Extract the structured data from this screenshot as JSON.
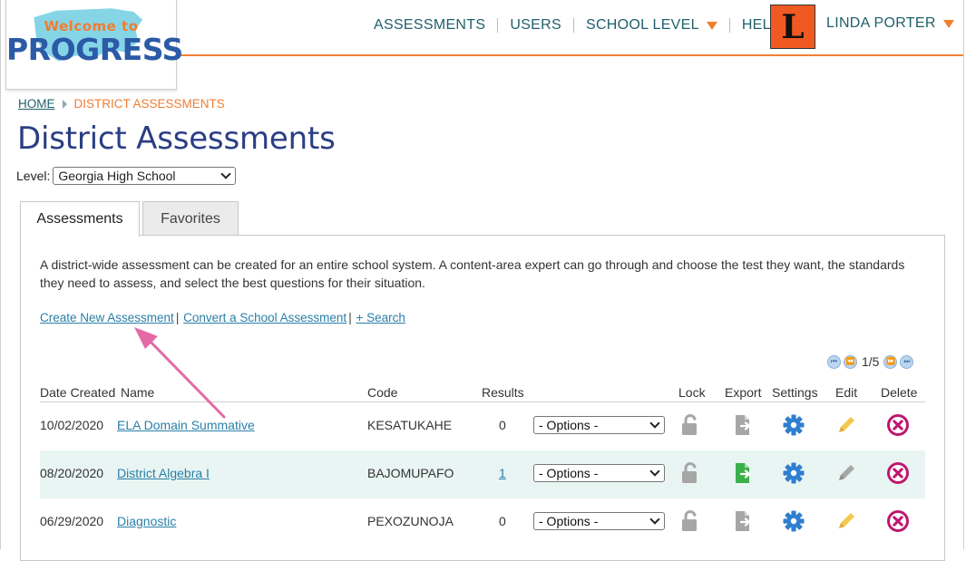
{
  "logo": {
    "line1": "Welcome to",
    "line2": "PROGRESS"
  },
  "nav": {
    "items": [
      {
        "label": "ASSESSMENTS",
        "has_caret": false
      },
      {
        "label": "USERS",
        "has_caret": false
      },
      {
        "label": "SCHOOL LEVEL",
        "has_caret": true
      },
      {
        "label": "HELP",
        "has_caret": true
      }
    ],
    "avatar_letter": "L",
    "user_name": "LINDA PORTER"
  },
  "breadcrumb": {
    "home": "HOME",
    "current": "DISTRICT ASSESSMENTS"
  },
  "page_title": "District Assessments",
  "level": {
    "label": "Level:",
    "selected": "Georgia High School"
  },
  "tabs": [
    {
      "label": "Assessments",
      "active": true
    },
    {
      "label": "Favorites",
      "active": false
    }
  ],
  "description": "A district-wide assessment can be created for an entire school system. A content-area expert can go through and choose the test they want, the standards they need to assess, and select the best questions for their situation.",
  "links": {
    "create": "Create New Assessment",
    "convert": "Convert a School Assessment",
    "search": "+ Search",
    "separator": "|"
  },
  "pager": {
    "count": "1/5"
  },
  "table": {
    "headers": {
      "date": "Date Created",
      "name": "Name",
      "code": "Code",
      "results": "Results",
      "lock": "Lock",
      "export": "Export",
      "settings": "Settings",
      "edit": "Edit",
      "delete": "Delete"
    },
    "rows": [
      {
        "date": "10/02/2020",
        "name": "ELA Domain Summative",
        "code": "KESATUKAHE",
        "results": "0",
        "results_link": false,
        "options": "- Options -",
        "export_active": false,
        "edit_active": true
      },
      {
        "date": "08/20/2020",
        "name": "District Algebra I",
        "code": "BAJOMUPAFO",
        "results": "1",
        "results_link": true,
        "options": "- Options -",
        "export_active": true,
        "edit_active": false
      },
      {
        "date": "06/29/2020",
        "name": "Diagnostic",
        "code": "PEXOZUNOJA",
        "results": "0",
        "results_link": false,
        "options": "- Options -",
        "export_active": false,
        "edit_active": true
      }
    ]
  },
  "colors": {
    "accent_orange": "#ef7d33",
    "nav_teal": "#1f5f6b",
    "title_navy": "#2a3e84",
    "link_blue": "#2a7fa8",
    "settings_blue": "#2f7fd0",
    "delete_magenta": "#c0176e",
    "export_green": "#3bb04a",
    "edit_yellow": "#f2c94c",
    "annotation_pink": "#e46aa6"
  }
}
